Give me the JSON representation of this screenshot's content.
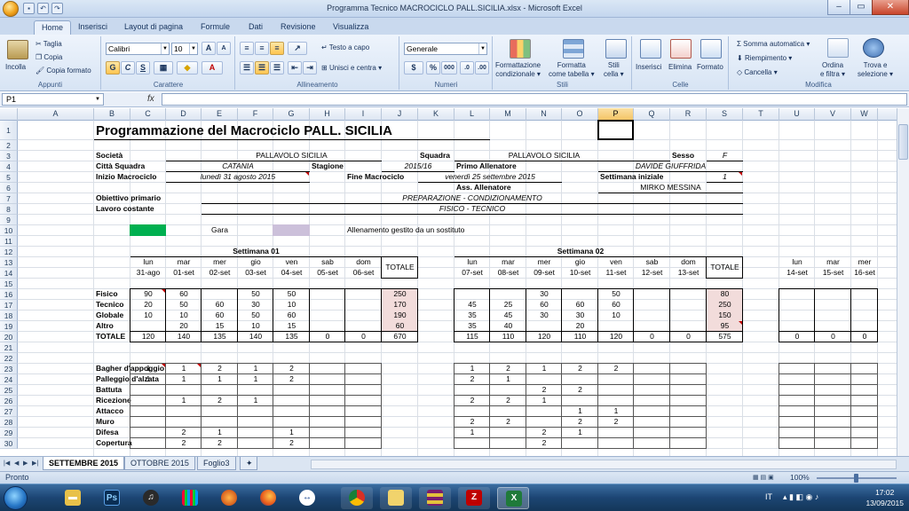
{
  "window": {
    "title": "Programma Tecnico  MACROCICLO PALL.SICILIA.xlsx - Microsoft Excel"
  },
  "tabs": [
    "Home",
    "Inserisci",
    "Layout di pagina",
    "Formule",
    "Dati",
    "Revisione",
    "Visualizza"
  ],
  "ribbon": {
    "appunti": {
      "label": "Appunti",
      "incolla": "Incolla",
      "taglia": "Taglia",
      "copia": "Copia",
      "copia_formato": "Copia formato"
    },
    "carattere": {
      "label": "Carattere",
      "font": "Calibri",
      "size": "10"
    },
    "allineamento": {
      "label": "Allineamento",
      "testo_capo": "Testo a capo",
      "unisci": "Unisci e centra"
    },
    "numeri": {
      "label": "Numeri",
      "format": "Generale"
    },
    "stili": {
      "label": "Stili",
      "formattazione": "Formattazione",
      "condizionale": "condizionale",
      "formatta": "Formatta",
      "come_tabella": "come tabella",
      "stili": "Stili",
      "cella": "cella"
    },
    "celle": {
      "label": "Celle",
      "inserisci": "Inserisci",
      "elimina": "Elimina",
      "formato": "Formato"
    },
    "modifica": {
      "label": "Modifica",
      "somma": "Somma automatica",
      "riempimento": "Riempimento",
      "cancella": "Cancella",
      "ordina": "Ordina",
      "e_filtra": "e filtra",
      "trova": "Trova e",
      "seleziona": "selezione"
    }
  },
  "formula_bar": {
    "name_box": "P1",
    "fx": "fx",
    "value": ""
  },
  "columns": [
    "A",
    "B",
    "C",
    "D",
    "E",
    "F",
    "G",
    "H",
    "I",
    "J",
    "K",
    "L",
    "M",
    "N",
    "O",
    "P",
    "Q",
    "R",
    "S",
    "T",
    "U",
    "V",
    "W"
  ],
  "selected_column": "P",
  "sheet": {
    "title": "Programmazione del Macrociclo PALL. SICILIA",
    "societa_label": "Società",
    "societa": "PALLAVOLO SICILIA",
    "citta_label": "Città Squadra",
    "citta": "CATANIA",
    "stagione_label": "Stagione",
    "stagione": "2015/16",
    "inizio_label": "Inizio Macrociclo",
    "inizio": "lunedì 31 agosto 2015",
    "fine_label": "Fine Macrociclo",
    "fine": "venerdì 25 settembre 2015",
    "squadra_label": "Squadra",
    "squadra": "PALLAVOLO SICILIA",
    "primo_all_label": "Primo Allenatore",
    "primo_all": "DAVIDE GIUFFRIDA",
    "ass_all_label": "Ass. Allenatore",
    "ass_all": "MIRKO MESSINA",
    "sesso_label": "Sesso",
    "sesso": "F",
    "settimana_label": "Settimana iniziale",
    "settimana": "1",
    "obiettivo_label": "Obiettivo primario",
    "obiettivo": "PREPARAZIONE - CONDIZIONAMENTO",
    "lavoro_label": "Lavoro costante",
    "lavoro": "FISICO - TECNICO",
    "legend_gara": "Gara",
    "legend_sostituto": "Allenamento gestito da un sostituto",
    "totale": "TOTALE",
    "week1": {
      "title": "Settimana 01",
      "days": [
        "lun",
        "mar",
        "mer",
        "gio",
        "ven",
        "sab",
        "dom"
      ],
      "dates": [
        "31-ago",
        "01-set",
        "02-set",
        "03-set",
        "04-set",
        "05-set",
        "06-set"
      ]
    },
    "week2": {
      "title": "Settimana 02",
      "days": [
        "lun",
        "mar",
        "mer",
        "gio",
        "ven",
        "sab",
        "dom"
      ],
      "dates": [
        "07-set",
        "08-set",
        "09-set",
        "10-set",
        "11-set",
        "12-set",
        "13-set"
      ]
    },
    "week3": {
      "days": [
        "lun",
        "mar",
        "mer"
      ],
      "dates": [
        "14-set",
        "15-set",
        "16-set"
      ]
    },
    "load_rows": [
      {
        "row": "16",
        "label": "Fisico",
        "w1": [
          "90",
          "60",
          "",
          "50",
          "50",
          "",
          ""
        ],
        "t1": "250",
        "w2": [
          "",
          "",
          "30",
          "",
          "50",
          "",
          ""
        ],
        "t2": "80"
      },
      {
        "row": "17",
        "label": "Tecnico",
        "w1": [
          "20",
          "50",
          "60",
          "30",
          "10",
          "",
          ""
        ],
        "t1": "170",
        "w2": [
          "45",
          "25",
          "60",
          "60",
          "60",
          "",
          ""
        ],
        "t2": "250"
      },
      {
        "row": "18",
        "label": "Globale",
        "w1": [
          "10",
          "10",
          "60",
          "50",
          "60",
          "",
          ""
        ],
        "t1": "190",
        "w2": [
          "35",
          "45",
          "30",
          "30",
          "10",
          "",
          ""
        ],
        "t2": "150"
      },
      {
        "row": "19",
        "label": "Altro",
        "w1": [
          "",
          "20",
          "15",
          "10",
          "15",
          "",
          ""
        ],
        "t1": "60",
        "w2": [
          "35",
          "40",
          "",
          "20",
          "",
          "",
          ""
        ],
        "t2": "95"
      }
    ],
    "total_row": {
      "row": "20",
      "label": "TOTALE",
      "w1": [
        "120",
        "140",
        "135",
        "140",
        "135",
        "0",
        "0"
      ],
      "t1": "670",
      "w2": [
        "115",
        "110",
        "120",
        "110",
        "120",
        "0",
        "0"
      ],
      "t2": "575",
      "w3": [
        "0",
        "0",
        "0"
      ]
    },
    "skill_rows": [
      {
        "row": "23",
        "label": "Bagher d'appoggio",
        "w1": [
          "1",
          "1",
          "2",
          "1",
          "2",
          "",
          ""
        ],
        "w2": [
          "1",
          "2",
          "1",
          "2",
          "2",
          "",
          ""
        ]
      },
      {
        "row": "24",
        "label": "Palleggio d'alzata",
        "w1": [
          "1",
          "1",
          "1",
          "1",
          "2",
          "",
          ""
        ],
        "w2": [
          "2",
          "1",
          "",
          "",
          "",
          "",
          ""
        ]
      },
      {
        "row": "25",
        "label": "Battuta",
        "w1": [
          "",
          "",
          "",
          "",
          "",
          "",
          ""
        ],
        "w2": [
          "",
          "",
          "2",
          "2",
          "",
          "",
          ""
        ]
      },
      {
        "row": "26",
        "label": "Ricezione",
        "w1": [
          "",
          "1",
          "2",
          "1",
          "",
          "",
          ""
        ],
        "w2": [
          "2",
          "2",
          "1",
          "",
          "",
          "",
          ""
        ]
      },
      {
        "row": "27",
        "label": "Attacco",
        "w1": [
          "",
          "",
          "",
          "",
          "",
          "",
          ""
        ],
        "w2": [
          "",
          "",
          "",
          "1",
          "1",
          "",
          ""
        ]
      },
      {
        "row": "28",
        "label": "Muro",
        "w1": [
          "",
          "",
          "",
          "",
          "",
          "",
          ""
        ],
        "w2": [
          "2",
          "2",
          "",
          "2",
          "2",
          "",
          ""
        ]
      },
      {
        "row": "29",
        "label": "Difesa",
        "w1": [
          "",
          "2",
          "1",
          "",
          "1",
          "",
          ""
        ],
        "w2": [
          "1",
          "",
          "2",
          "1",
          "",
          "",
          ""
        ]
      },
      {
        "row": "30",
        "label": "Copertura",
        "w1": [
          "",
          "2",
          "2",
          "",
          "2",
          "",
          ""
        ],
        "w2": [
          "",
          "",
          "2",
          "",
          "",
          "",
          ""
        ]
      }
    ],
    "row_numbers": [
      "1",
      "2",
      "3",
      "4",
      "5",
      "6",
      "7",
      "8",
      "9",
      "10",
      "11",
      "12",
      "13",
      "14",
      "15",
      "16",
      "17",
      "18",
      "19",
      "20",
      "21",
      "22",
      "23",
      "24",
      "25",
      "26",
      "27",
      "28",
      "29",
      "30"
    ]
  },
  "sheet_tabs": [
    "SETTEMBRE 2015",
    "OTTOBRE 2015",
    "Foglio3"
  ],
  "active_sheet_tab": "SETTEMBRE 2015",
  "status": {
    "text": "Pronto",
    "zoom": "100%"
  },
  "taskbar": {
    "lang": "IT",
    "time": "17:02",
    "date": "13/09/2015"
  },
  "colors": {
    "gara": "#00b050",
    "sostituto": "#ccc0da",
    "totale_fill": "#f2dcdb"
  }
}
